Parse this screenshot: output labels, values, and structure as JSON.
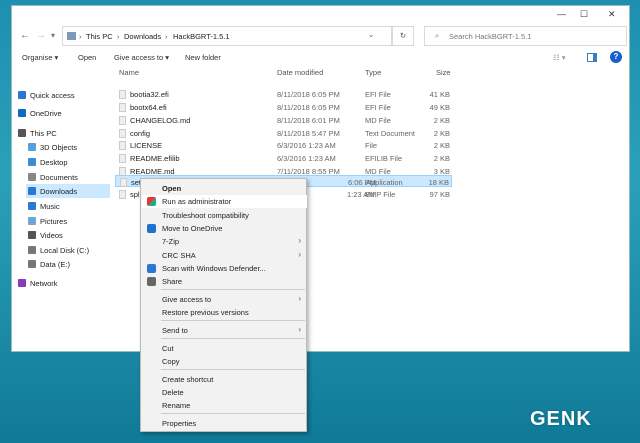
{
  "window": {
    "minimize": "—",
    "maximize": "☐",
    "close": "✕"
  },
  "nav": {
    "back": "←",
    "forward": "→",
    "recent": "▾",
    "breadcrumb": [
      "This PC",
      "Downloads",
      "HackBGRT-1.5.1"
    ],
    "dropdown": "⌄",
    "refresh": "↻"
  },
  "search": {
    "placeholder": "Search HackBGRT-1.5.1"
  },
  "toolbar": {
    "organise": "Organise ▾",
    "open": "Open",
    "give_access": "Give access to ▾",
    "new_folder": "New folder"
  },
  "sidebar": [
    {
      "label": "Quick access",
      "icon": "star-icon",
      "color": "#2b78d4"
    },
    {
      "label": "OneDrive",
      "icon": "cloud-icon",
      "color": "#0f6cbd"
    },
    {
      "label": "This PC",
      "icon": "computer-icon",
      "color": "#555"
    },
    {
      "label": "3D Objects",
      "icon": "cube-icon",
      "color": "#5aa0d8"
    },
    {
      "label": "Desktop",
      "icon": "desktop-icon",
      "color": "#3b8ed4"
    },
    {
      "label": "Documents",
      "icon": "documents-icon",
      "color": "#888"
    },
    {
      "label": "Downloads",
      "icon": "download-icon",
      "color": "#2b78d4"
    },
    {
      "label": "Music",
      "icon": "music-icon",
      "color": "#2b78d4"
    },
    {
      "label": "Pictures",
      "icon": "pictures-icon",
      "color": "#6aa8d8"
    },
    {
      "label": "Videos",
      "icon": "video-icon",
      "color": "#555"
    },
    {
      "label": "Local Disk (C:)",
      "icon": "drive-icon",
      "color": "#777"
    },
    {
      "label": "Data (E:)",
      "icon": "drive-icon",
      "color": "#777"
    },
    {
      "label": "Network",
      "icon": "network-icon",
      "color": "#8a3ab9"
    }
  ],
  "columns": {
    "name": "Name",
    "date": "Date modified",
    "type": "Type",
    "size": "Size"
  },
  "files": [
    {
      "name": "bootia32.efi",
      "date": "8/11/2018 6:05 PM",
      "type": "EFI File",
      "size": "41 KB"
    },
    {
      "name": "bootx64.efi",
      "date": "8/11/2018 6:05 PM",
      "type": "EFI File",
      "size": "49 KB"
    },
    {
      "name": "CHANGELOG.md",
      "date": "8/11/2018 6:01 PM",
      "type": "MD File",
      "size": "2 KB"
    },
    {
      "name": "config",
      "date": "8/11/2018 5:47 PM",
      "type": "Text Document",
      "size": "2 KB"
    },
    {
      "name": "LICENSE",
      "date": "6/3/2016 1:23 AM",
      "type": "File",
      "size": "2 KB"
    },
    {
      "name": "README.efilib",
      "date": "6/3/2016 1:23 AM",
      "type": "EFILIB File",
      "size": "2 KB"
    },
    {
      "name": "README.md",
      "date": "7/11/2018 8:55 PM",
      "type": "MD File",
      "size": "3 KB"
    },
    {
      "name": "set",
      "date": "6:06 PM",
      "type": "Application",
      "size": "18 KB"
    },
    {
      "name": "spl",
      "date": "1:23 AM",
      "type": "BMP File",
      "size": "97 KB"
    }
  ],
  "menu": [
    {
      "label": "Open",
      "bold": true
    },
    {
      "label": "Run as administrator",
      "icon": "shield-icon"
    },
    {
      "label": "Troubleshoot compatibility"
    },
    {
      "label": "Move to OneDrive",
      "icon": "cloud-icon"
    },
    {
      "label": "7-Zip",
      "sub": true
    },
    {
      "label": "CRC SHA",
      "sub": true
    },
    {
      "label": "Scan with Windows Defender...",
      "icon": "defender-icon"
    },
    {
      "label": "Share",
      "icon": "share-icon"
    },
    {
      "label": "Give access to",
      "sub": true
    },
    {
      "label": "Restore previous versions"
    },
    {
      "label": "Send to",
      "sub": true
    },
    {
      "label": "Cut"
    },
    {
      "label": "Copy"
    },
    {
      "label": "Create shortcut"
    },
    {
      "label": "Delete"
    },
    {
      "label": "Rename"
    },
    {
      "label": "Properties"
    }
  ],
  "watermark": "GENK"
}
